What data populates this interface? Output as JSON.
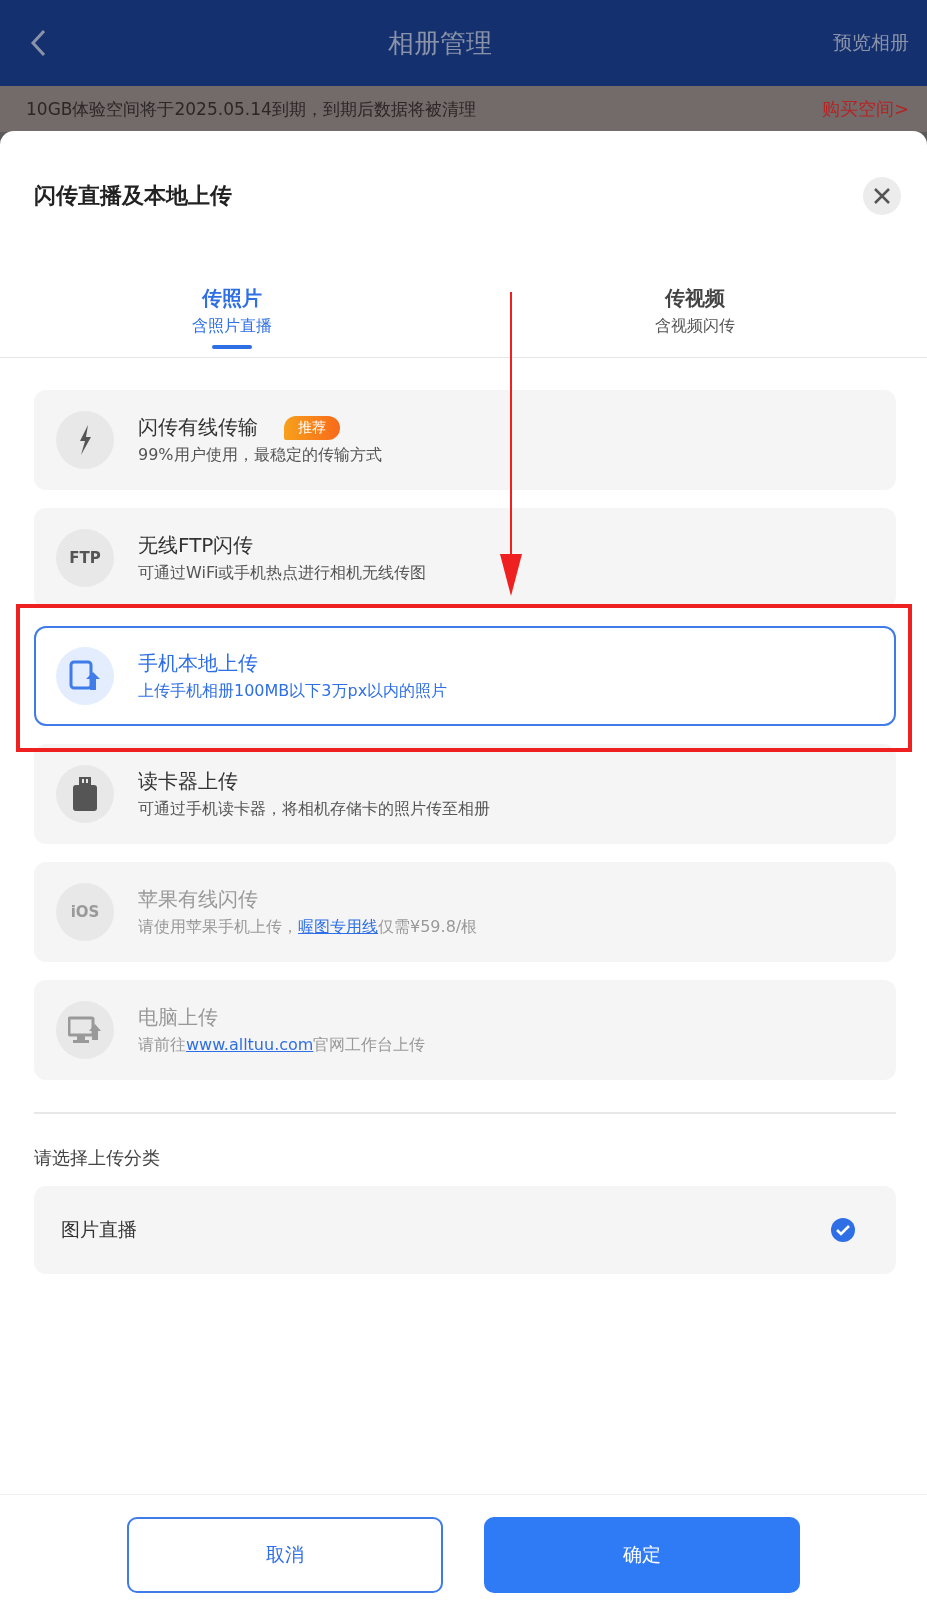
{
  "header": {
    "title": "相册管理",
    "action": "预览相册"
  },
  "notice": {
    "text": "10GB体验空间将于2025.05.14到期，到期后数据将被清理",
    "link": "购买空间>"
  },
  "sheet": {
    "title": "闪传直播及本地上传",
    "tabs": [
      {
        "label": "传照片",
        "sublabel": "含照片直播",
        "selected": true
      },
      {
        "label": "传视频",
        "sublabel": "含视频闪传",
        "selected": false
      }
    ],
    "options": [
      {
        "kind": "bolt",
        "title": "闪传有线传输",
        "badge": "推荐",
        "selected": false,
        "disabled": false,
        "description": [
          {
            "text": "99%用户使用，最稳定的传输方式",
            "link": false
          }
        ]
      },
      {
        "kind": "label",
        "icon_text": "FTP",
        "title": "无线FTP闪传",
        "selected": false,
        "disabled": false,
        "description": [
          {
            "text": "可通过WiFi或手机热点进行相机无线传图",
            "link": false
          }
        ]
      },
      {
        "kind": "tablet",
        "title": "手机本地上传",
        "selected": true,
        "disabled": false,
        "description": [
          {
            "text": "上传手机相册100MB以下3万px以内的照片",
            "link": false
          }
        ]
      },
      {
        "kind": "card",
        "title": "读卡器上传",
        "selected": false,
        "disabled": false,
        "description": [
          {
            "text": "可通过手机读卡器，将相机存储卡的照片传至相册",
            "link": false
          }
        ]
      },
      {
        "kind": "label",
        "icon_text": "iOS",
        "title": "苹果有线闪传",
        "selected": false,
        "disabled": true,
        "description": [
          {
            "text": "请使用苹果手机上传，",
            "link": false
          },
          {
            "text": "喔图专用线",
            "link": true
          },
          {
            "text": "仅需¥59.8/根",
            "link": false
          }
        ]
      },
      {
        "kind": "monitor",
        "title": "电脑上传",
        "selected": false,
        "disabled": true,
        "description": [
          {
            "text": "请前往",
            "link": false
          },
          {
            "text": "www.alltuu.com",
            "link": true
          },
          {
            "text": "官网工作台上传",
            "link": false
          }
        ]
      }
    ],
    "category_label": "请选择上传分类",
    "categories": [
      {
        "label": "图片直播",
        "checked": true
      }
    ],
    "buttons": [
      {
        "label": "取消",
        "kind": "secondary"
      },
      {
        "label": "确定",
        "kind": "primary"
      }
    ]
  }
}
